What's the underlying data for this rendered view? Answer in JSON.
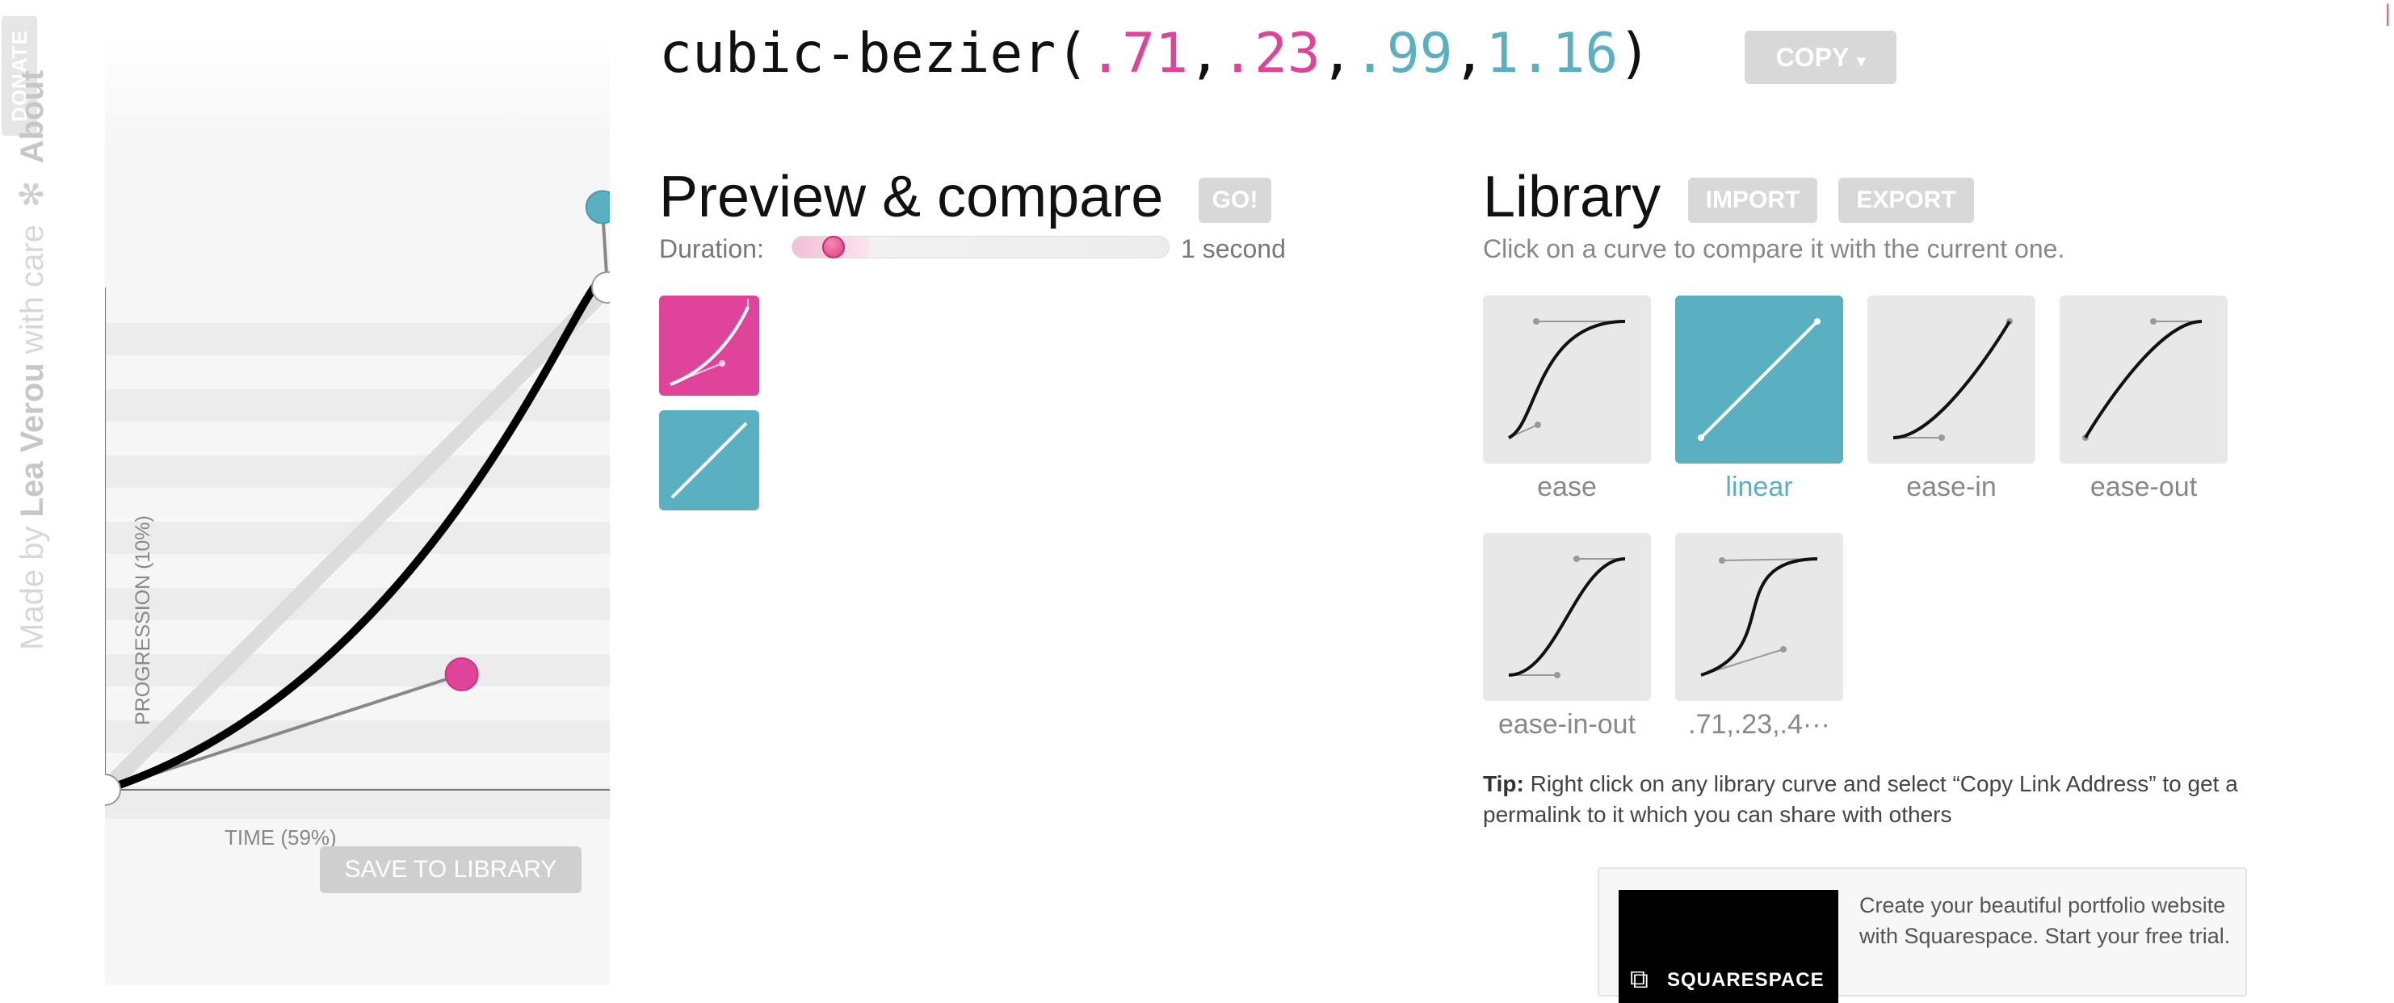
{
  "sidebar": {
    "made_by": "Made by",
    "author": "Lea Verou",
    "with_care": "with care",
    "flower": "✻",
    "about": "About",
    "donate": "DONATE"
  },
  "header": {
    "code_prefix": "cubic-bezier(",
    "p1x": ".71",
    "p1y": ".23",
    "p2x": ".99",
    "p2y": "1.16",
    "comma": ",",
    "code_suffix": ")",
    "copy_label": "COPY",
    "copy_caret": "▾"
  },
  "graph": {
    "y_axis_label": "PROGRESSION (10%)",
    "x_axis_label": "TIME (59%)",
    "save_label": "SAVE TO LIBRARY",
    "curve": [
      0.71,
      0.23,
      0.99,
      1.16
    ]
  },
  "preview": {
    "title": "Preview & compare",
    "go_label": "GO!",
    "duration_label": "Duration:",
    "duration_value": "1 second",
    "duration_fraction": 0.1
  },
  "library": {
    "title": "Library",
    "import_label": "IMPORT",
    "export_label": "EXPORT",
    "description": "Click on a curve to compare it with the current one.",
    "items": [
      {
        "label": "ease",
        "active": false
      },
      {
        "label": "linear",
        "active": true
      },
      {
        "label": "ease-in",
        "active": false
      },
      {
        "label": "ease-out",
        "active": false
      },
      {
        "label": "ease-in-out",
        "active": false
      },
      {
        "label": ".71,.23,.4···",
        "active": false
      }
    ]
  },
  "tip": {
    "bold": "Tip:",
    "text": " Right click on any library curve and select “Copy Link Address” to get a permalink to it which you can share with others"
  },
  "ad": {
    "brand": "SQUARESPACE",
    "text": "Create your beautiful portfolio website with Squarespace. Start your free trial."
  },
  "colors": {
    "pink": "#e0449a",
    "teal": "#5aafc0",
    "button_gray": "#d8d8d8"
  }
}
